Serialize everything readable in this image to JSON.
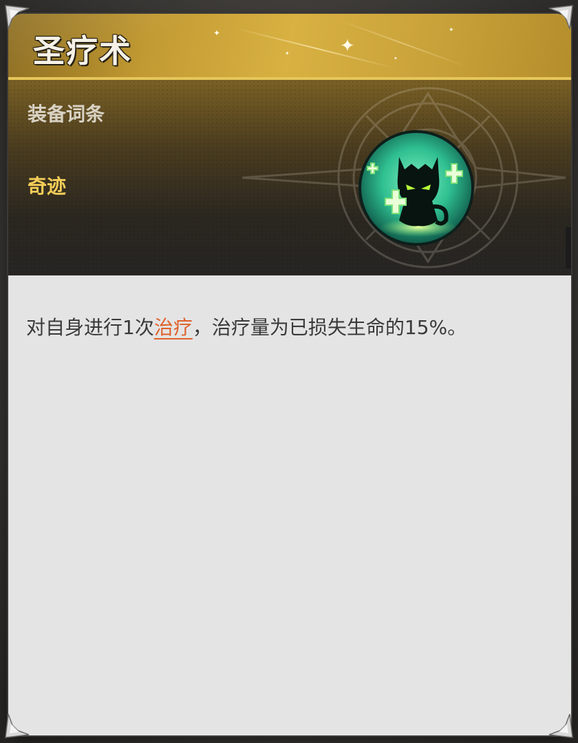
{
  "card": {
    "title": "圣疗术",
    "category_label": "装备词条",
    "quality_label": "奇迹",
    "icon": "healing-demon-icon",
    "description": {
      "prefix": "对自身进行1次",
      "keyword": "治疗",
      "suffix": "，治疗量为已损失生命的15%。"
    }
  },
  "colors": {
    "title_gold": "#d8b142",
    "quality_gold": "#f3cd58",
    "keyword_orange": "#e0602a",
    "panel_bg": "#e4e4e4",
    "icon_green": "#4ee0a0"
  }
}
